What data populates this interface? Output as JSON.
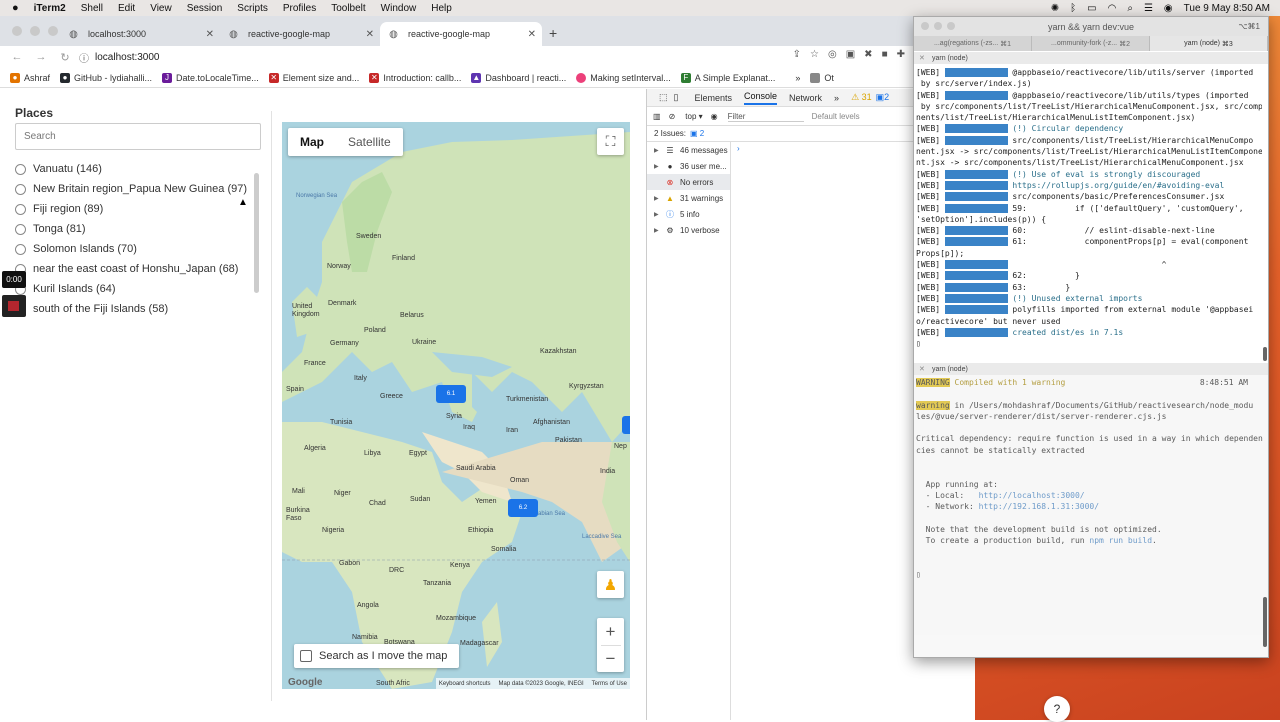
{
  "menubar": {
    "app": "iTerm2",
    "items": [
      "Shell",
      "Edit",
      "View",
      "Session",
      "Scripts",
      "Profiles",
      "Toolbelt",
      "Window",
      "Help"
    ],
    "datetime": "Tue 9 May  8:50 AM"
  },
  "browser": {
    "tabs": [
      {
        "title": "localhost:3000",
        "active": false
      },
      {
        "title": "reactive-google-map",
        "active": false
      },
      {
        "title": "reactive-google-map",
        "active": true
      }
    ],
    "url": "localhost:3000",
    "bookmarks": [
      {
        "label": "Ashraf",
        "color": "#e37400"
      },
      {
        "label": "GitHub - lydiahalli...",
        "color": "#24292e"
      },
      {
        "label": "Date.toLocaleTime...",
        "color": "#6a1b9a"
      },
      {
        "label": "Element size and...",
        "color": "#c62828"
      },
      {
        "label": "Introduction: callb...",
        "color": "#c62828"
      },
      {
        "label": "Dashboard | reacti...",
        "color": "#5e35b1"
      },
      {
        "label": "Making setInterval...",
        "color": "#ec407a"
      },
      {
        "label": "A Simple Explanat...",
        "color": "#2e7d32"
      }
    ],
    "bookmarks_overflow": "»",
    "bookmarks_other": "Ot"
  },
  "places": {
    "title": "Places",
    "search_placeholder": "Search",
    "items": [
      "Vanuatu (146)",
      "New Britain region_Papua New Guinea (97)",
      "Fiji region (89)",
      "Tonga (81)",
      "Solomon Islands (70)",
      "near the east coast of Honshu_Japan (68)",
      "Kuril Islands (64)",
      "south of the Fiji Islands (58)"
    ]
  },
  "recorder": {
    "time": "0:00"
  },
  "map": {
    "type_buttons": [
      "Map",
      "Satellite"
    ],
    "selected_type": "Map",
    "countries": [
      {
        "name": "Sweden"
      },
      {
        "name": "Finland"
      },
      {
        "name": "Norway"
      },
      {
        "name": "Denmark"
      },
      {
        "name": "United Kingdom"
      },
      {
        "name": "Belarus"
      },
      {
        "name": "Poland"
      },
      {
        "name": "Ukraine"
      },
      {
        "name": "Germany"
      },
      {
        "name": "France"
      },
      {
        "name": "Kazakhstan"
      },
      {
        "name": "Spain"
      },
      {
        "name": "Italy"
      },
      {
        "name": "Greece"
      },
      {
        "name": "Turkmenistan"
      },
      {
        "name": "Kyrgyzstan"
      },
      {
        "name": "Tunisia"
      },
      {
        "name": "Syria"
      },
      {
        "name": "Iraq"
      },
      {
        "name": "Iran"
      },
      {
        "name": "Afghanistan"
      },
      {
        "name": "Algeria"
      },
      {
        "name": "Libya"
      },
      {
        "name": "Egypt"
      },
      {
        "name": "Pakistan"
      },
      {
        "name": "Nep"
      },
      {
        "name": "Saudi Arabia"
      },
      {
        "name": "India"
      },
      {
        "name": "Oman"
      },
      {
        "name": "Mali"
      },
      {
        "name": "Niger"
      },
      {
        "name": "Chad"
      },
      {
        "name": "Sudan"
      },
      {
        "name": "Yemen"
      },
      {
        "name": "Burkina Faso"
      },
      {
        "name": "Nigeria"
      },
      {
        "name": "Ethiopia"
      },
      {
        "name": "Somalia"
      },
      {
        "name": "Gabon"
      },
      {
        "name": "DRC"
      },
      {
        "name": "Kenya"
      },
      {
        "name": "Tanzania"
      },
      {
        "name": "Angola"
      },
      {
        "name": "Mozambique"
      },
      {
        "name": "Namibia"
      },
      {
        "name": "Madagascar"
      },
      {
        "name": "Botswana"
      },
      {
        "name": "South Afric"
      }
    ],
    "seas": [
      "Norwegian Sea",
      "Arabian Sea",
      "Laccadive Sea"
    ],
    "markers": [
      "6.1",
      "6.2"
    ],
    "search_as_move": "Search as I move the map",
    "attribution": {
      "keyboard": "Keyboard shortcuts",
      "data": "Map data ©2023 Google, INEGI",
      "terms": "Terms of Use"
    },
    "logo": "Google"
  },
  "devtools": {
    "tabs": [
      "Elements",
      "Console",
      "Network"
    ],
    "active_tab": "Console",
    "warn_count": "31",
    "info_count": "2",
    "context": "top",
    "filter_placeholder": "Filter",
    "levels": "Default levels",
    "issues_label": "2 Issues:",
    "issues_count": "2",
    "sidebar": [
      {
        "label": "46 messages",
        "icon": "list-icon"
      },
      {
        "label": "36 user me...",
        "icon": "user-icon"
      },
      {
        "label": "No errors",
        "icon": "error-icon"
      },
      {
        "label": "31 warnings",
        "icon": "warning-icon"
      },
      {
        "label": "5 info",
        "icon": "info-icon"
      },
      {
        "label": "10 verbose",
        "icon": "verbose-icon"
      }
    ]
  },
  "iterm": {
    "window_title": "yarn && yarn dev:vue",
    "shortcut": "⌥⌘1",
    "tabs": [
      {
        "label": "...ag(regations (-zs...",
        "key": "⌘1"
      },
      {
        "label": "...ommunity-fork (-z...",
        "key": "⌘2"
      },
      {
        "label": "yarn (node)",
        "key": "⌘3"
      }
    ],
    "pane1_title": "yarn (node)",
    "pane1_lines": [
      {
        "prefix": "[WEB]",
        "text": "@appbaseio/reactivecore/lib/utils/server (imported"
      },
      {
        "prefix": "",
        "text": " by src/server/index.js)"
      },
      {
        "prefix": "[WEB]",
        "text": "@appbaseio/reactivecore/lib/utils/types (imported"
      },
      {
        "prefix": "",
        "text": " by src/components/list/TreeList/HierarchicalMenuComponent.jsx, src/compo"
      },
      {
        "prefix": "",
        "text": "nents/list/TreeList/HierarchicalMenuListItemComponent.jsx)"
      },
      {
        "prefix": "[WEB]",
        "text": "(!) Circular dependency"
      },
      {
        "prefix": "[WEB]",
        "text": "src/components/list/TreeList/HierarchicalMenuCompo"
      },
      {
        "prefix": "",
        "text": "nent.jsx -> src/components/list/TreeList/HierarchicalMenuListItemCompone"
      },
      {
        "prefix": "",
        "text": "nt.jsx -> src/components/list/TreeList/HierarchicalMenuComponent.jsx"
      },
      {
        "prefix": "[WEB]",
        "text": "(!) Use of eval is strongly discouraged"
      },
      {
        "prefix": "[WEB]",
        "text": "https://rollupjs.org/guide/en/#avoiding-eval"
      },
      {
        "prefix": "[WEB]",
        "text": "src/components/basic/PreferencesConsumer.jsx"
      },
      {
        "prefix": "[WEB]",
        "text": "59:          if (['defaultQuery', 'customQuery',"
      },
      {
        "prefix": "",
        "text": "'setOption'].includes(p)) {"
      },
      {
        "prefix": "[WEB]",
        "text": "60:            // eslint-disable-next-line"
      },
      {
        "prefix": "[WEB]",
        "text": "61:            componentProps[p] = eval(component"
      },
      {
        "prefix": "",
        "text": "Props[p]);"
      },
      {
        "prefix": "[WEB]",
        "text": "                               ^"
      },
      {
        "prefix": "[WEB]",
        "text": "62:          }"
      },
      {
        "prefix": "[WEB]",
        "text": "63:        }"
      },
      {
        "prefix": "[WEB]",
        "text": "(!) Unused external imports"
      },
      {
        "prefix": "[WEB]",
        "text": "polyfills imported from external module '@appbasei"
      },
      {
        "prefix": "",
        "text": "o/reactivecore' but never used"
      },
      {
        "prefix": "[WEB]",
        "text": "created dist/es in 7.1s"
      }
    ],
    "pane2_title": "yarn (node)",
    "pane2": {
      "warning_tag": "WARNING",
      "compiled": "Compiled with 1 warning",
      "time": "8:48:51 AM",
      "warning_word": "warning",
      "warning_path": " in /Users/mohdashraf/Documents/GitHub/reactivesearch/node_modu",
      "warning_path2": "les/@vue/server-renderer/dist/server-renderer.cjs.js",
      "critical": "Critical dependency: require function is used in a way in which dependen",
      "critical2": "cies cannot be statically extracted",
      "running": "  App running at:",
      "local_label": "  - Local:   ",
      "local_url": "http://localhost:3000/",
      "network_label": "  - Network: ",
      "network_url": "http://192.168.1.31:3000/",
      "note": "  Note that the development build is not optimized.",
      "prod": "  To create a production build, run ",
      "prod_cmd": "npm run build",
      "prod_end": "."
    }
  }
}
